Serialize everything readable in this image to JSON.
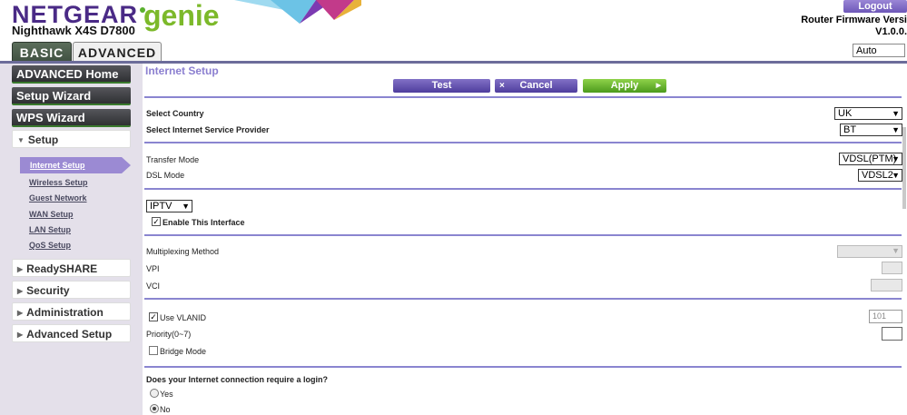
{
  "header": {
    "brand": "NETGEAR",
    "brand_suffix": "genie",
    "model": "Nighthawk X4S D7800",
    "logout_label": "Logout",
    "firmware_label": "Router Firmware Versi",
    "firmware_version": "V1.0.0.",
    "language": "Auto",
    "colors": {
      "brand_purple": "#4a2a86",
      "genie_green": "#7cb92a"
    }
  },
  "tabs": [
    {
      "label": "BASIC"
    },
    {
      "label": "ADVANCED"
    }
  ],
  "sidebar": {
    "main_items": [
      {
        "label": "ADVANCED Home"
      },
      {
        "label": "Setup Wizard"
      },
      {
        "label": "WPS Wizard"
      }
    ],
    "setup": {
      "label": "Setup",
      "arrow": "▼"
    },
    "setup_sub": [
      {
        "label": "Internet Setup"
      },
      {
        "label": "Wireless Setup"
      },
      {
        "label": "Guest Network"
      },
      {
        "label": "WAN Setup"
      },
      {
        "label": "LAN Setup"
      },
      {
        "label": "QoS Setup"
      }
    ],
    "sections": [
      {
        "label": "ReadySHARE",
        "arrow": "▶"
      },
      {
        "label": "Security",
        "arrow": "▶"
      },
      {
        "label": "Administration",
        "arrow": "▶"
      },
      {
        "label": "Advanced Setup",
        "arrow": "▶"
      }
    ]
  },
  "main": {
    "title": "Internet Setup",
    "buttons": {
      "test": "Test",
      "cancel": "Cancel",
      "cancel_icon": "×",
      "apply": "Apply",
      "apply_icon": "▶"
    },
    "country": {
      "label": "Select Country",
      "value": "UK"
    },
    "isp": {
      "label": "Select Internet Service Provider",
      "value": "BT"
    },
    "transfer_mode": {
      "label": "Transfer Mode",
      "value": "VDSL(PTM)"
    },
    "dsl_mode": {
      "label": "DSL Mode",
      "value": "VDSL2"
    },
    "interface": {
      "value": "IPTV",
      "enable_label": "Enable This Interface",
      "enable_checked": true
    },
    "multiplexing": {
      "label": "Multiplexing Method"
    },
    "vpi": {
      "label": "VPI"
    },
    "vci": {
      "label": "VCI"
    },
    "vlan": {
      "label": "Use VLANID",
      "checked": true,
      "value": "101"
    },
    "priority": {
      "label": "Priority(0~7)"
    },
    "bridge": {
      "label": "Bridge Mode",
      "checked": false
    },
    "login": {
      "question": "Does your Internet connection require a login?",
      "yes_label": "Yes",
      "no_label": "No",
      "selected": "No"
    },
    "chevron": "▼",
    "check_mark": "✓"
  }
}
